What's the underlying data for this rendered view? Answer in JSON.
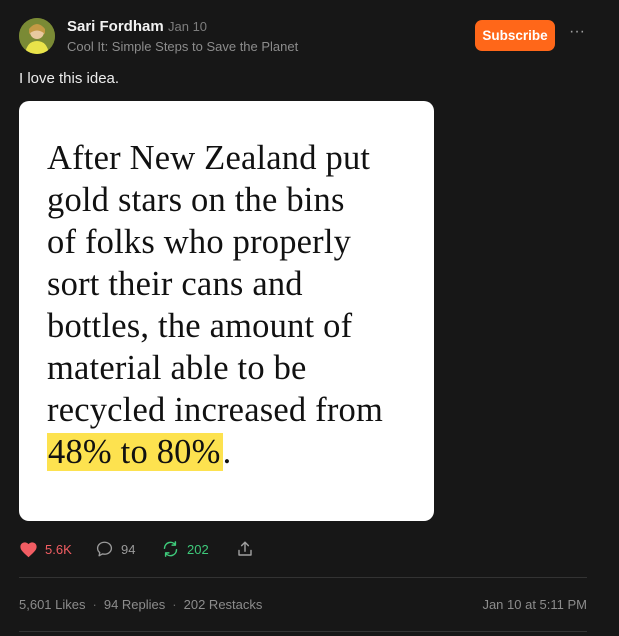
{
  "author": {
    "name": "Sari Fordham",
    "date": "Jan 10",
    "publication": "Cool It: Simple Steps to Save the Planet"
  },
  "header": {
    "subscribe_label": "Subscribe",
    "more_label": "···"
  },
  "post": {
    "text": "I love this idea.",
    "image_quote": {
      "lines": [
        "After New Zealand put",
        "gold stars on the bins",
        "of folks who properly",
        "sort their cans and",
        "bottles, the amount of",
        "material able to be",
        "recycled increased from"
      ],
      "highlight": "48% to 80%",
      "tail": "."
    }
  },
  "actions": {
    "likes": "5.6K",
    "replies": "94",
    "restacks": "202"
  },
  "stats": {
    "likes": "5,601 Likes",
    "replies": "94 Replies",
    "restacks": "202 Restacks",
    "separator": "·",
    "timestamp": "Jan 10 at 5:11 PM"
  },
  "colors": {
    "background": "#171717",
    "subscribe": "#ff6719",
    "like": "#f25d63",
    "restack": "#3ec97a",
    "highlight": "#fde24f"
  },
  "icons": [
    "heart-icon",
    "comment-icon",
    "restack-icon",
    "share-icon",
    "more-icon"
  ]
}
